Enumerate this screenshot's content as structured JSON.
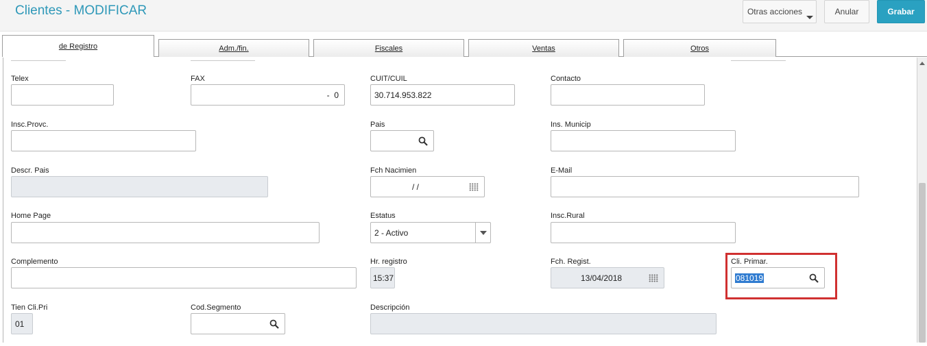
{
  "header": {
    "title": "Clientes - MODIFICAR",
    "more_actions_label": "Otras acciones",
    "cancel_label": "Anular",
    "save_label": "Grabar"
  },
  "tabs": [
    {
      "label": "de Registro",
      "active": true
    },
    {
      "label": "Adm./fin.",
      "active": false
    },
    {
      "label": "Fiscales",
      "active": false
    },
    {
      "label": "Ventas",
      "active": false
    },
    {
      "label": "Otros",
      "active": false
    }
  ],
  "form": {
    "telex": {
      "label": "Telex",
      "value": ""
    },
    "fax": {
      "label": "FAX",
      "value": "-  0"
    },
    "cuit": {
      "label": "CUIT/CUIL",
      "value": "30.714.953.822"
    },
    "contacto": {
      "label": "Contacto",
      "value": ""
    },
    "insc_provc": {
      "label": "Insc.Provc.",
      "value": ""
    },
    "pais": {
      "label": "Pais",
      "value": ""
    },
    "ins_municip": {
      "label": "Ins. Municip",
      "value": ""
    },
    "descr_pais": {
      "label": "Descr. Pais",
      "value": ""
    },
    "fch_nacimien": {
      "label": "Fch Nacimien",
      "value": "/ /"
    },
    "email": {
      "label": "E-Mail",
      "value": ""
    },
    "home_page": {
      "label": "Home Page",
      "value": ""
    },
    "estatus": {
      "label": "Estatus",
      "value": "2 - Activo"
    },
    "insc_rural": {
      "label": "Insc.Rural",
      "value": ""
    },
    "complemento": {
      "label": "Complemento",
      "value": ""
    },
    "hr_registro": {
      "label": "Hr. registro",
      "value": "15:37"
    },
    "fch_regist": {
      "label": "Fch. Regist.",
      "value": "13/04/2018"
    },
    "cli_primar": {
      "label": "Cli. Primar.",
      "value": "081019"
    },
    "tien_cli_pri": {
      "label": "Tien Cli.Pri",
      "value": "01"
    },
    "cod_segmento": {
      "label": "Cod.Segmento",
      "value": ""
    },
    "descripcion": {
      "label": "Descripción",
      "value": ""
    }
  },
  "colors": {
    "accent": "#2aa1c1",
    "title": "#2e98b8",
    "highlight": "#d03030",
    "readonly_bg": "#e8ebef"
  },
  "icons": {
    "search": "magnifier-icon",
    "calendar": "calendar-icon",
    "dropdown": "chevron-down-icon"
  }
}
